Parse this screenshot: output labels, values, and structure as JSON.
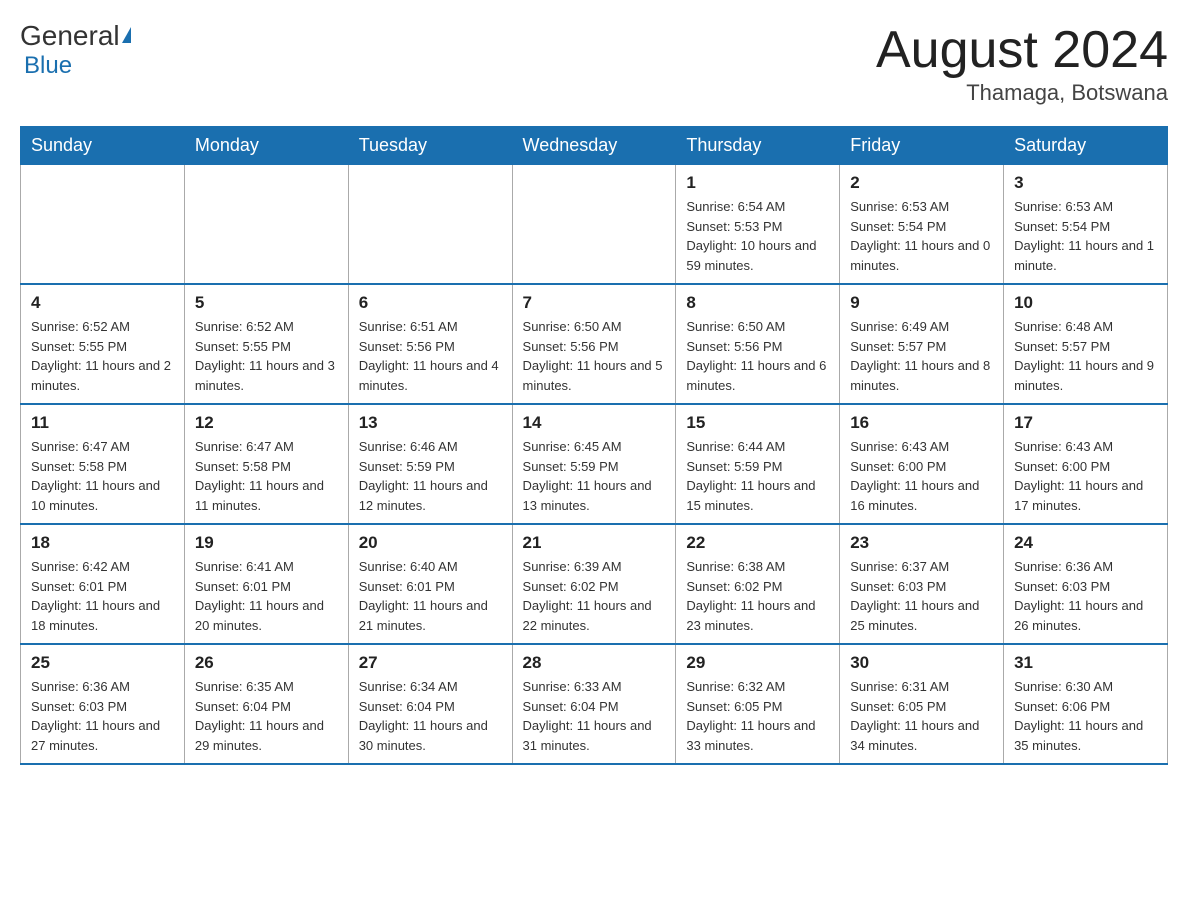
{
  "header": {
    "logo_general": "General",
    "logo_blue": "Blue",
    "month_title": "August 2024",
    "location": "Thamaga, Botswana"
  },
  "days_of_week": [
    "Sunday",
    "Monday",
    "Tuesday",
    "Wednesday",
    "Thursday",
    "Friday",
    "Saturday"
  ],
  "weeks": [
    [
      {
        "day": "",
        "info": ""
      },
      {
        "day": "",
        "info": ""
      },
      {
        "day": "",
        "info": ""
      },
      {
        "day": "",
        "info": ""
      },
      {
        "day": "1",
        "info": "Sunrise: 6:54 AM\nSunset: 5:53 PM\nDaylight: 10 hours and 59 minutes."
      },
      {
        "day": "2",
        "info": "Sunrise: 6:53 AM\nSunset: 5:54 PM\nDaylight: 11 hours and 0 minutes."
      },
      {
        "day": "3",
        "info": "Sunrise: 6:53 AM\nSunset: 5:54 PM\nDaylight: 11 hours and 1 minute."
      }
    ],
    [
      {
        "day": "4",
        "info": "Sunrise: 6:52 AM\nSunset: 5:55 PM\nDaylight: 11 hours and 2 minutes."
      },
      {
        "day": "5",
        "info": "Sunrise: 6:52 AM\nSunset: 5:55 PM\nDaylight: 11 hours and 3 minutes."
      },
      {
        "day": "6",
        "info": "Sunrise: 6:51 AM\nSunset: 5:56 PM\nDaylight: 11 hours and 4 minutes."
      },
      {
        "day": "7",
        "info": "Sunrise: 6:50 AM\nSunset: 5:56 PM\nDaylight: 11 hours and 5 minutes."
      },
      {
        "day": "8",
        "info": "Sunrise: 6:50 AM\nSunset: 5:56 PM\nDaylight: 11 hours and 6 minutes."
      },
      {
        "day": "9",
        "info": "Sunrise: 6:49 AM\nSunset: 5:57 PM\nDaylight: 11 hours and 8 minutes."
      },
      {
        "day": "10",
        "info": "Sunrise: 6:48 AM\nSunset: 5:57 PM\nDaylight: 11 hours and 9 minutes."
      }
    ],
    [
      {
        "day": "11",
        "info": "Sunrise: 6:47 AM\nSunset: 5:58 PM\nDaylight: 11 hours and 10 minutes."
      },
      {
        "day": "12",
        "info": "Sunrise: 6:47 AM\nSunset: 5:58 PM\nDaylight: 11 hours and 11 minutes."
      },
      {
        "day": "13",
        "info": "Sunrise: 6:46 AM\nSunset: 5:59 PM\nDaylight: 11 hours and 12 minutes."
      },
      {
        "day": "14",
        "info": "Sunrise: 6:45 AM\nSunset: 5:59 PM\nDaylight: 11 hours and 13 minutes."
      },
      {
        "day": "15",
        "info": "Sunrise: 6:44 AM\nSunset: 5:59 PM\nDaylight: 11 hours and 15 minutes."
      },
      {
        "day": "16",
        "info": "Sunrise: 6:43 AM\nSunset: 6:00 PM\nDaylight: 11 hours and 16 minutes."
      },
      {
        "day": "17",
        "info": "Sunrise: 6:43 AM\nSunset: 6:00 PM\nDaylight: 11 hours and 17 minutes."
      }
    ],
    [
      {
        "day": "18",
        "info": "Sunrise: 6:42 AM\nSunset: 6:01 PM\nDaylight: 11 hours and 18 minutes."
      },
      {
        "day": "19",
        "info": "Sunrise: 6:41 AM\nSunset: 6:01 PM\nDaylight: 11 hours and 20 minutes."
      },
      {
        "day": "20",
        "info": "Sunrise: 6:40 AM\nSunset: 6:01 PM\nDaylight: 11 hours and 21 minutes."
      },
      {
        "day": "21",
        "info": "Sunrise: 6:39 AM\nSunset: 6:02 PM\nDaylight: 11 hours and 22 minutes."
      },
      {
        "day": "22",
        "info": "Sunrise: 6:38 AM\nSunset: 6:02 PM\nDaylight: 11 hours and 23 minutes."
      },
      {
        "day": "23",
        "info": "Sunrise: 6:37 AM\nSunset: 6:03 PM\nDaylight: 11 hours and 25 minutes."
      },
      {
        "day": "24",
        "info": "Sunrise: 6:36 AM\nSunset: 6:03 PM\nDaylight: 11 hours and 26 minutes."
      }
    ],
    [
      {
        "day": "25",
        "info": "Sunrise: 6:36 AM\nSunset: 6:03 PM\nDaylight: 11 hours and 27 minutes."
      },
      {
        "day": "26",
        "info": "Sunrise: 6:35 AM\nSunset: 6:04 PM\nDaylight: 11 hours and 29 minutes."
      },
      {
        "day": "27",
        "info": "Sunrise: 6:34 AM\nSunset: 6:04 PM\nDaylight: 11 hours and 30 minutes."
      },
      {
        "day": "28",
        "info": "Sunrise: 6:33 AM\nSunset: 6:04 PM\nDaylight: 11 hours and 31 minutes."
      },
      {
        "day": "29",
        "info": "Sunrise: 6:32 AM\nSunset: 6:05 PM\nDaylight: 11 hours and 33 minutes."
      },
      {
        "day": "30",
        "info": "Sunrise: 6:31 AM\nSunset: 6:05 PM\nDaylight: 11 hours and 34 minutes."
      },
      {
        "day": "31",
        "info": "Sunrise: 6:30 AM\nSunset: 6:06 PM\nDaylight: 11 hours and 35 minutes."
      }
    ]
  ]
}
